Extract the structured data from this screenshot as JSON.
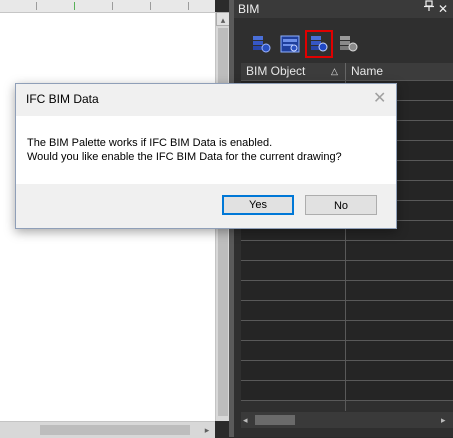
{
  "palette": {
    "title": "BIM",
    "pin": "ᵖ",
    "close": "✕",
    "columns": {
      "object": "BIM Object",
      "sort": "△",
      "name": "Name"
    },
    "tools": [
      {
        "icon": "bim-data-icon"
      },
      {
        "icon": "bim-browser-icon"
      },
      {
        "icon": "bim-palette-icon",
        "selected": true
      },
      {
        "icon": "bim-settings-icon"
      }
    ],
    "hscroll": {
      "left": "◂",
      "right": "▸"
    }
  },
  "drawing": {
    "vscroll": {
      "up": "▴"
    },
    "hscroll": {
      "right": "▸"
    }
  },
  "dialog": {
    "title": "IFC BIM Data",
    "close": "✕",
    "line1": "The BIM Palette works if IFC BIM Data is enabled.",
    "line2": "Would you like enable the IFC BIM Data for the current drawing?",
    "yes": "Yes",
    "no": "No"
  },
  "colors": {
    "accent": "#0078d7",
    "selection": "#e00000"
  }
}
